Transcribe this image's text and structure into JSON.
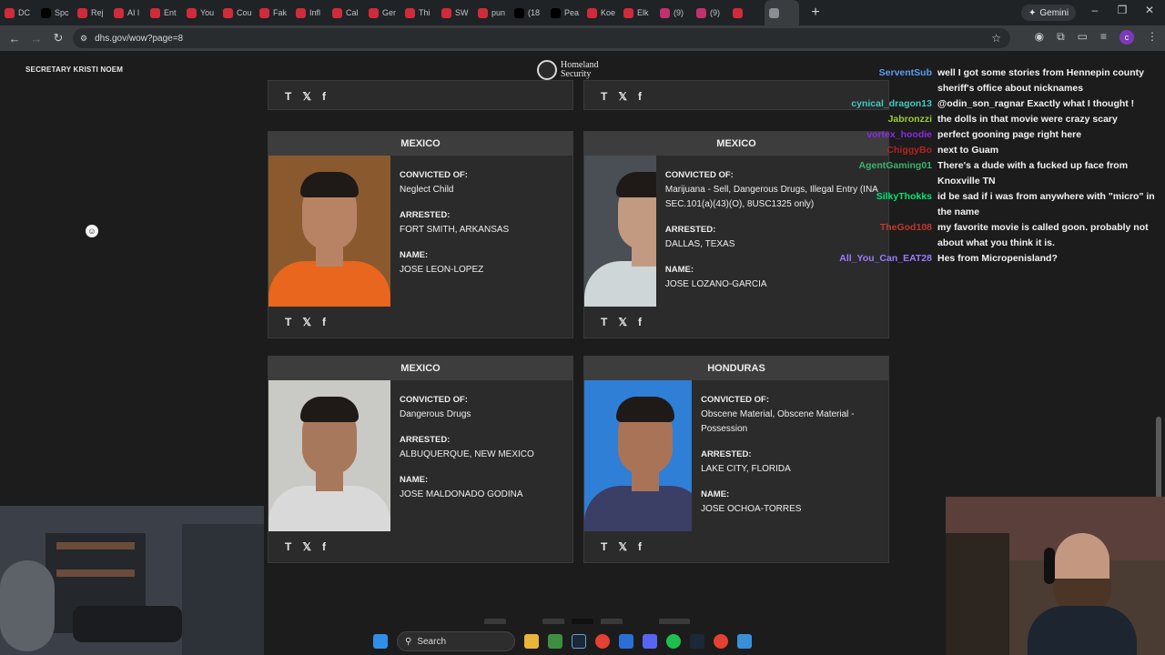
{
  "tabs": [
    "DC",
    "Spc",
    "Rej",
    "AI l",
    "Ent",
    "You",
    "Cou",
    "Fak",
    "Infl",
    "Cal",
    "Ger",
    "Thi",
    "SW",
    "pun",
    "(18",
    "Pea",
    "Koe",
    "Elk",
    "(9)",
    "(9)",
    "",
    ""
  ],
  "gemini_label": "Gemini",
  "url": "dhs.gov/wow?page=8",
  "profile_initial": "c",
  "header": {
    "secretary": "SECRETARY KRISTI NOEM",
    "logo_line1": "Homeland",
    "logo_line2": "Security"
  },
  "labels": {
    "convicted": "CONVICTED OF:",
    "arrested": "ARRESTED:",
    "name": "NAME:"
  },
  "cards": [
    {
      "country": "MEXICO",
      "convicted": "Neglect Child",
      "arrested": "FORT SMITH, ARKANSAS",
      "name": "JOSE LEON-LOPEZ"
    },
    {
      "country": "MEXICO",
      "convicted": "Marijuana - Sell, Dangerous Drugs, Illegal Entry (INA SEC.101(a)(43)(O), 8USC1325 only)",
      "arrested": "DALLAS, TEXAS",
      "name": "JOSE LOZANO-GARCIA"
    },
    {
      "country": "MEXICO",
      "convicted": "Dangerous Drugs",
      "arrested": "ALBUQUERQUE, NEW MEXICO",
      "name": "JOSE MALDONADO GODINA"
    },
    {
      "country": "HONDURAS",
      "convicted": "Obscene Material, Obscene Material - Possession",
      "arrested": "LAKE CITY, FLORIDA",
      "name": "JOSE OCHOA-TORRES"
    }
  ],
  "share_icons": [
    "truth-social-icon",
    "x-icon",
    "facebook-icon"
  ],
  "chat": [
    {
      "user": "ServentSub",
      "color": "#5b9cf5",
      "text": "well I got some stories from Hennepin county sheriff's office about nicknames"
    },
    {
      "user": "cynical_dragon13",
      "color": "#41c9c0",
      "text": "@odin_son_ragnar Exactly what I thought !"
    },
    {
      "user": "Jabronzzi",
      "color": "#9acd32",
      "text": "the dolls in that movie were crazy scary"
    },
    {
      "user": "vortex_hoodie",
      "color": "#8a2be2",
      "text": "perfect gooning page right here"
    },
    {
      "user": "ChiggyBo",
      "color": "#b22222",
      "text": "next to Guam"
    },
    {
      "user": "AgentGaming01",
      "color": "#3cb371",
      "text": "There's a dude with a fucked up face from Knoxville TN"
    },
    {
      "user": "SilkyThokks",
      "color": "#00e676",
      "text": "id be sad if i was from anywhere with \"micro\" in the name"
    },
    {
      "user": "TheGod108",
      "color": "#c0392b",
      "text": "my favorite movie is called goon. probably not about what you think it is."
    },
    {
      "user": "All_You_Can_EAT28",
      "color": "#9b7bff",
      "text": "Hes from Micropenisland?"
    }
  ],
  "taskbar": {
    "search_placeholder": "Search"
  }
}
